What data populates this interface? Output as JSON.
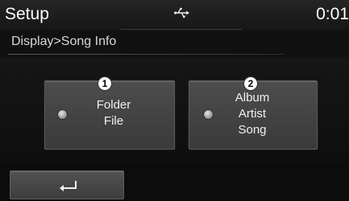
{
  "header": {
    "title": "Setup",
    "status_icon": "usb-icon",
    "clock": "0:01"
  },
  "breadcrumb": "Display>Song Info",
  "options": [
    {
      "badge": "1",
      "lines": [
        "Folder",
        "File"
      ],
      "indicator_icon": "radio-indicator-icon"
    },
    {
      "badge": "2",
      "lines": [
        "Album",
        "Artist",
        "Song"
      ],
      "indicator_icon": "radio-indicator-icon"
    }
  ],
  "footer": {
    "back_icon": "back-arrow-icon"
  },
  "colors": {
    "background": "#111111",
    "button": "#464646",
    "text": "#f0f0f0",
    "badge": "#ffffff"
  }
}
